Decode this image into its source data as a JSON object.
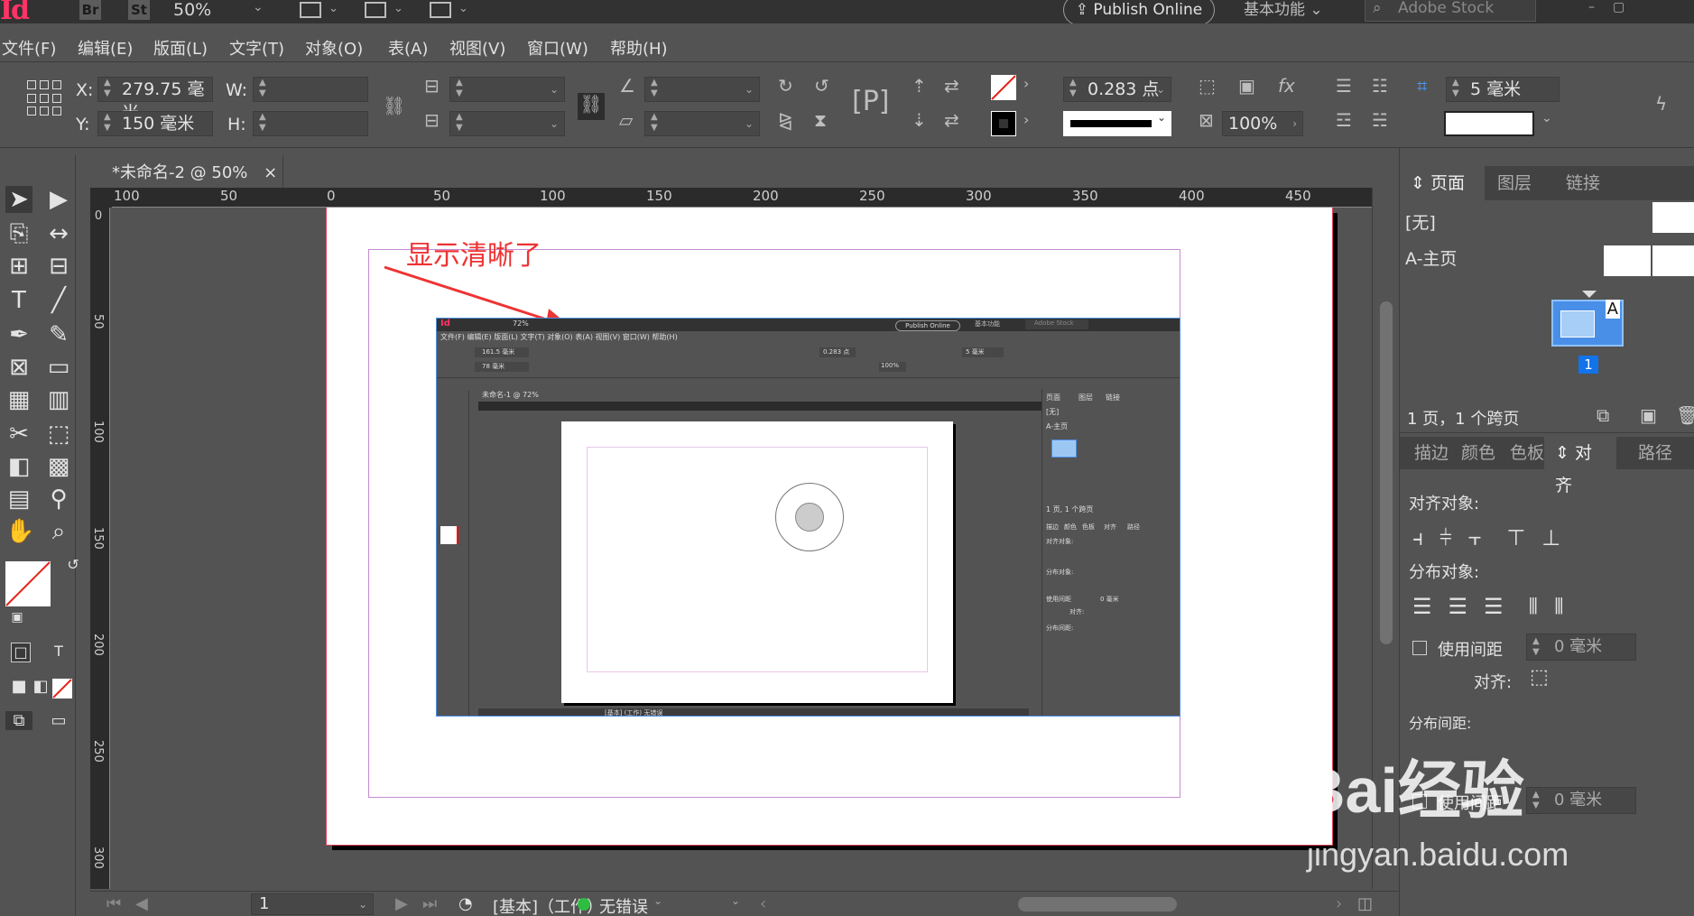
{
  "app": {
    "logo_text": "Id",
    "bridge_label": "Br",
    "stock_label": "St",
    "zoom_level": "50%",
    "publish_button": "Publish Online",
    "workspace": "基本功能",
    "search_placeholder": "Adobe Stock"
  },
  "menu": {
    "items": [
      "文件(F)",
      "编辑(E)",
      "版面(L)",
      "文字(T)",
      "对象(O)",
      "表(A)",
      "视图(V)",
      "窗口(W)",
      "帮助(H)"
    ]
  },
  "control_panel": {
    "x_label": "X:",
    "x_value": "279.75 毫米",
    "y_label": "Y:",
    "y_value": "150 毫米",
    "w_label": "W:",
    "w_value": "",
    "h_label": "H:",
    "h_value": "",
    "stroke_weight": "0.283 点",
    "opacity": "100%",
    "corner_size": "5 毫米"
  },
  "document": {
    "tab_title": "*未命名-2 @ 50%",
    "close_icon": "×"
  },
  "rulers": {
    "h_labels": [
      "100",
      "50",
      "0",
      "50",
      "100",
      "150",
      "200",
      "250",
      "300",
      "350",
      "400",
      "450"
    ],
    "v_labels": [
      "0",
      "50",
      "100",
      "150",
      "200",
      "250",
      "300"
    ]
  },
  "canvas": {
    "annotation": "显示清晰了",
    "annotation_color": "#ee3333",
    "embedded": {
      "zoom": "72%",
      "publish": "Publish Online",
      "workspace": "基本功能",
      "search": "Adobe Stock",
      "tab_title": "未命名-1 @ 72%",
      "menu": "文件(F)  编辑(E)  版面(L)  文字(T)  对象(O)  表(A)  视图(V)  窗口(W)  帮助(H)",
      "x_value": "161.5 毫米",
      "y_value": "78 毫米",
      "stroke_weight": "0.283 点",
      "opacity": "100%",
      "corner_size": "5 毫米",
      "panel_tabs": [
        "页面",
        "图层",
        "链接"
      ],
      "panel_none": "[无]",
      "panel_master": "A-主页",
      "panel_summary": "1 页, 1 个跨页",
      "align_tabs": [
        "描边",
        "颜色",
        "色板",
        "对齐",
        "路径"
      ],
      "align_objects": "对齐对象:",
      "distribute_objects": "分布对象:",
      "use_spacing": "使用间距",
      "spacing_value": "0 毫米",
      "align_to": "对齐:",
      "distribute_spacing": "分布间距:",
      "status": "[基本] (工作)    无错误"
    }
  },
  "pages_panel": {
    "tabs": [
      "页面",
      "图层",
      "链接"
    ],
    "none_label": "[无]",
    "master_label": "A-主页",
    "page_number": "1",
    "master_letter": "A",
    "summary": "1 页，1 个跨页"
  },
  "align_panel": {
    "tabs": [
      "描边",
      "颜色",
      "色板",
      "对齐",
      "路径"
    ],
    "align_objects_label": "对齐对象:",
    "distribute_objects_label": "分布对象:",
    "use_spacing_label": "使用间距",
    "spacing_value": "0 毫米",
    "align_to_label": "对齐:",
    "distribute_spacing_label": "分布间距:",
    "use_spacing_label_2": "使用间距",
    "spacing_value_2": "0 毫米"
  },
  "status_bar": {
    "page": "1",
    "style": "[基本]（工作）",
    "preflight": "无错误"
  },
  "watermark": {
    "logo_text": "Bai经验",
    "url": "jingyan.baidu.com"
  },
  "colors": {
    "accent": "#1273eb",
    "app_logo": "#ff3366",
    "preflight_ok": "#2ebd40"
  }
}
